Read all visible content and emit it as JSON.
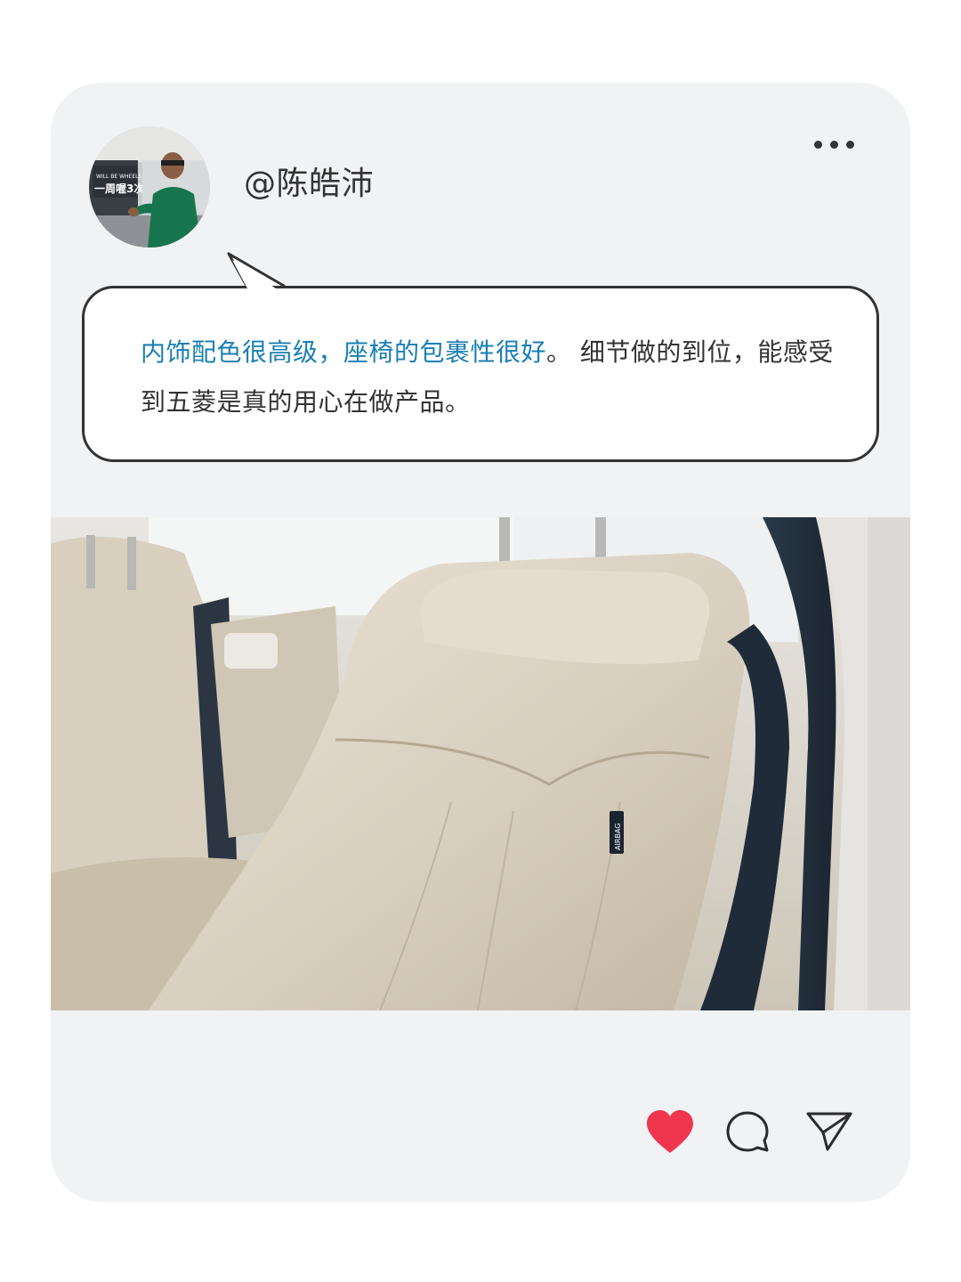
{
  "post": {
    "username": "@陈皓沛",
    "comment": {
      "highlight": "内饰配色很高级，座椅的包裹性很好",
      "rest": "。 细节做的到位，能感受到五菱是真的用心在做产品。"
    },
    "photo": {
      "badge_text": "AIRBAG"
    },
    "avatar": {
      "sign_text": "一周喔3次",
      "sign_small": "WILL BE WHEELS"
    }
  },
  "actions": {
    "like_icon": "heart-icon",
    "comment_icon": "comment-icon",
    "share_icon": "send-icon"
  },
  "colors": {
    "card_bg": "#f1f2f4",
    "highlight": "#1a7fb3",
    "text": "#333333",
    "heart": "#f0364f"
  }
}
